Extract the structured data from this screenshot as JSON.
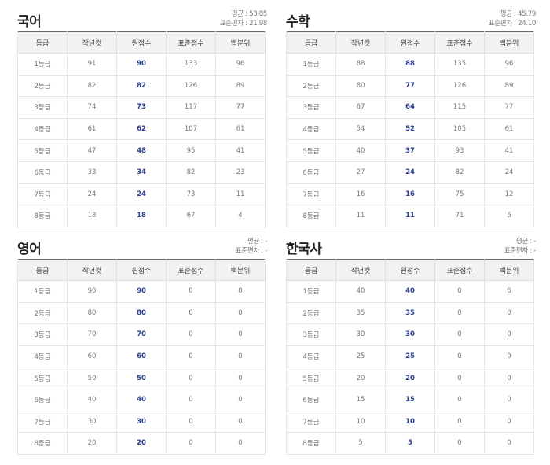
{
  "headers": [
    "등급",
    "작년컷",
    "원점수",
    "표준점수",
    "백분위"
  ],
  "panels": [
    {
      "title": "국어",
      "avg": "평균 : 53.85",
      "std": "표준편차 : 21.98",
      "rows": [
        [
          "1등급",
          "91",
          "90",
          "133",
          "96"
        ],
        [
          "2등급",
          "82",
          "82",
          "126",
          "89"
        ],
        [
          "3등급",
          "74",
          "73",
          "117",
          "77"
        ],
        [
          "4등급",
          "61",
          "62",
          "107",
          "61"
        ],
        [
          "5등급",
          "47",
          "48",
          "95",
          "41"
        ],
        [
          "6등급",
          "33",
          "34",
          "82",
          "23"
        ],
        [
          "7등급",
          "24",
          "24",
          "73",
          "11"
        ],
        [
          "8등급",
          "18",
          "18",
          "67",
          "4"
        ]
      ]
    },
    {
      "title": "수학",
      "avg": "평균 : 45.79",
      "std": "표준편차 : 24.10",
      "rows": [
        [
          "1등급",
          "88",
          "88",
          "135",
          "96"
        ],
        [
          "2등급",
          "80",
          "77",
          "126",
          "89"
        ],
        [
          "3등급",
          "67",
          "64",
          "115",
          "77"
        ],
        [
          "4등급",
          "54",
          "52",
          "105",
          "61"
        ],
        [
          "5등급",
          "40",
          "37",
          "93",
          "41"
        ],
        [
          "6등급",
          "27",
          "24",
          "82",
          "24"
        ],
        [
          "7등급",
          "16",
          "16",
          "75",
          "12"
        ],
        [
          "8등급",
          "11",
          "11",
          "71",
          "5"
        ]
      ]
    },
    {
      "title": "영어",
      "avg": "평균 : -",
      "std": "표준편차 : -",
      "rows": [
        [
          "1등급",
          "90",
          "90",
          "0",
          "0"
        ],
        [
          "2등급",
          "80",
          "80",
          "0",
          "0"
        ],
        [
          "3등급",
          "70",
          "70",
          "0",
          "0"
        ],
        [
          "4등급",
          "60",
          "60",
          "0",
          "0"
        ],
        [
          "5등급",
          "50",
          "50",
          "0",
          "0"
        ],
        [
          "6등급",
          "40",
          "40",
          "0",
          "0"
        ],
        [
          "7등급",
          "30",
          "30",
          "0",
          "0"
        ],
        [
          "8등급",
          "20",
          "20",
          "0",
          "0"
        ]
      ]
    },
    {
      "title": "한국사",
      "avg": "평균 : -",
      "std": "표준편차 : -",
      "rows": [
        [
          "1등급",
          "40",
          "40",
          "0",
          "0"
        ],
        [
          "2등급",
          "35",
          "35",
          "0",
          "0"
        ],
        [
          "3등급",
          "30",
          "30",
          "0",
          "0"
        ],
        [
          "4등급",
          "25",
          "25",
          "0",
          "0"
        ],
        [
          "5등급",
          "20",
          "20",
          "0",
          "0"
        ],
        [
          "6등급",
          "15",
          "15",
          "0",
          "0"
        ],
        [
          "7등급",
          "10",
          "10",
          "0",
          "0"
        ],
        [
          "8등급",
          "5",
          "5",
          "0",
          "0"
        ]
      ]
    }
  ]
}
